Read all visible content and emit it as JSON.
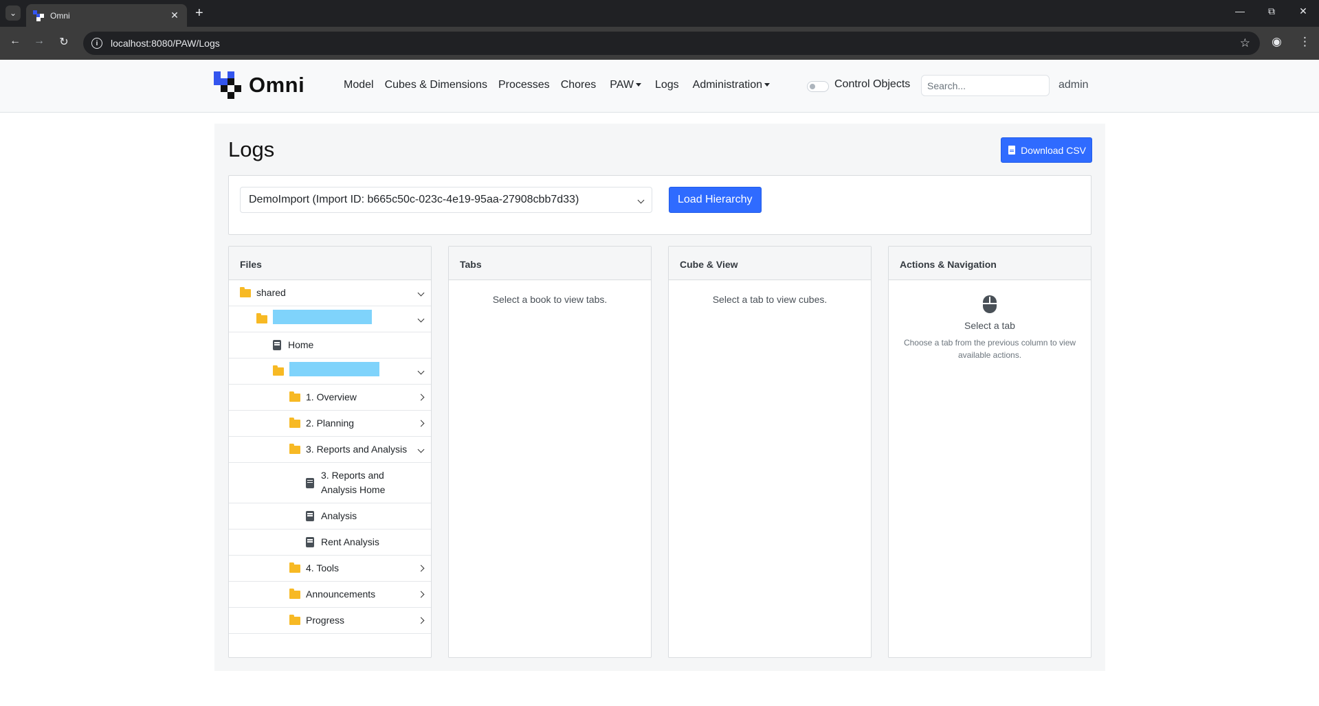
{
  "browser": {
    "tab_title": "Omni",
    "url": "localhost:8080/PAW/Logs"
  },
  "navbar": {
    "brand": "Omni",
    "links": [
      "Model",
      "Cubes & Dimensions",
      "Processes",
      "Chores",
      "PAW",
      "Logs",
      "Administration"
    ],
    "toggle_label": "Control Objects",
    "search_placeholder": "Search...",
    "user": "admin"
  },
  "page": {
    "title": "Logs",
    "download_label": "Download CSV",
    "import_select_value": "DemoImport (Import ID: b665c50c-023c-4e19-95aa-27908cbb7d33)",
    "load_label": "Load Hierarchy"
  },
  "files": {
    "header": "Files",
    "items": [
      {
        "label": "shared",
        "type": "folder",
        "state": "expanded"
      },
      {
        "label": "",
        "type": "folder",
        "state": "expanded",
        "redacted": true
      },
      {
        "label": "Home",
        "type": "book"
      },
      {
        "label": "",
        "type": "folder",
        "state": "expanded",
        "redacted": true
      },
      {
        "label": "1. Overview",
        "type": "folder",
        "state": "collapsed"
      },
      {
        "label": "2. Planning",
        "type": "folder",
        "state": "collapsed"
      },
      {
        "label": "3. Reports and Analysis",
        "type": "folder",
        "state": "expanded"
      },
      {
        "label": "3. Reports and Analysis Home",
        "type": "book"
      },
      {
        "label": "Analysis",
        "type": "book"
      },
      {
        "label": "Rent Analysis",
        "type": "book"
      },
      {
        "label": "4. Tools",
        "type": "folder",
        "state": "collapsed"
      },
      {
        "label": "Announcements",
        "type": "folder",
        "state": "collapsed"
      },
      {
        "label": "Progress",
        "type": "folder",
        "state": "collapsed"
      }
    ]
  },
  "tabs": {
    "header": "Tabs",
    "empty": "Select a book to view tabs."
  },
  "cube_view": {
    "header": "Cube & View",
    "empty": "Select a tab to view cubes."
  },
  "actions": {
    "header": "Actions & Navigation",
    "title": "Select a tab",
    "description": "Choose a tab from the previous column to view available actions."
  },
  "colors": {
    "primary": "#2f6bff",
    "folder": "#f7b924",
    "redaction": "#7fd3fb",
    "logo_blue": "#3355ee"
  },
  "icons": [
    "folder-icon",
    "book-icon",
    "mouse-icon",
    "chevron-down-icon",
    "chevron-right-icon",
    "file-csv-icon"
  ]
}
